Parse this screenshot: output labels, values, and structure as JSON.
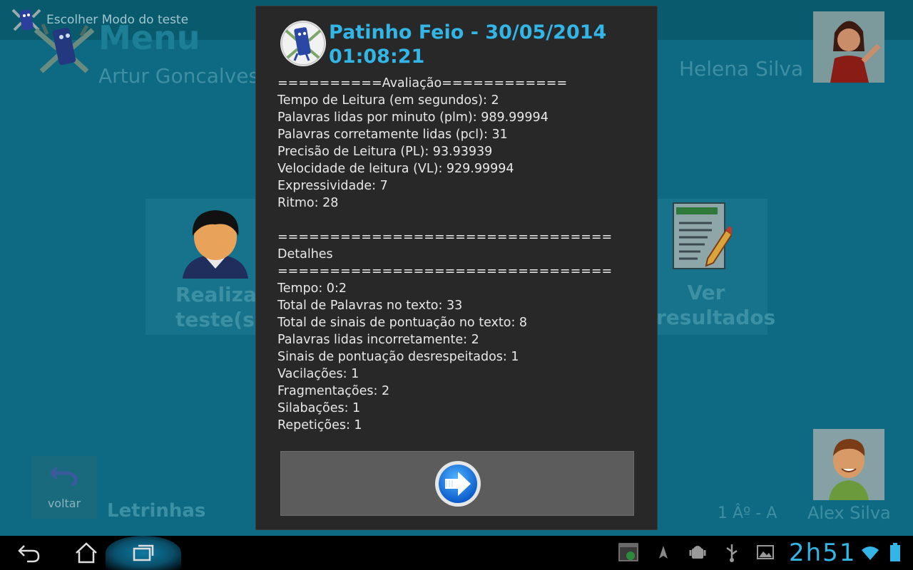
{
  "app": {
    "window_title": "Escolher Modo do teste",
    "menu_title": "Menu",
    "user_left": "Artur Goncalves",
    "user_right": "Helena Silva",
    "tile_test_label": "Realizar teste(s)",
    "tile_results_label": "Ver resultados",
    "back_label": "voltar",
    "app_name": "Letrinhas",
    "class_label": "1 Âº - A",
    "student_name": "Alex Silva"
  },
  "dialog": {
    "title": "Patinho Feio - 30/05/2014 01:08:21",
    "lines": [
      "==========Avaliação============",
      "Tempo de Leitura (em segundos): 2",
      "Palavras lidas por minuto (plm): 989.99994",
      "Palavras corretamente lidas (pcl): 31",
      "Precisão de Leitura (PL): 93.93939",
      "Velocidade de leitura (VL): 929.99994",
      "Expressividade: 7",
      "Ritmo: 28",
      "",
      "================================",
      "Detalhes",
      "================================",
      "Tempo: 0:2",
      "Total de Palavras no texto: 33",
      "Total de sinais de pontuação no texto: 8",
      "Palavras lidas incorretamente: 2",
      "Sinais de pontuação desrespeitados: 1",
      "Vacilações: 1",
      "Fragmentações: 2",
      "Silabações: 1",
      "Repetições: 1"
    ]
  },
  "statusbar": {
    "clock": "2h51"
  },
  "colors": {
    "accent": "#33b5e5",
    "dialog_bg": "#282828",
    "app_bg": "#0d6a82"
  }
}
